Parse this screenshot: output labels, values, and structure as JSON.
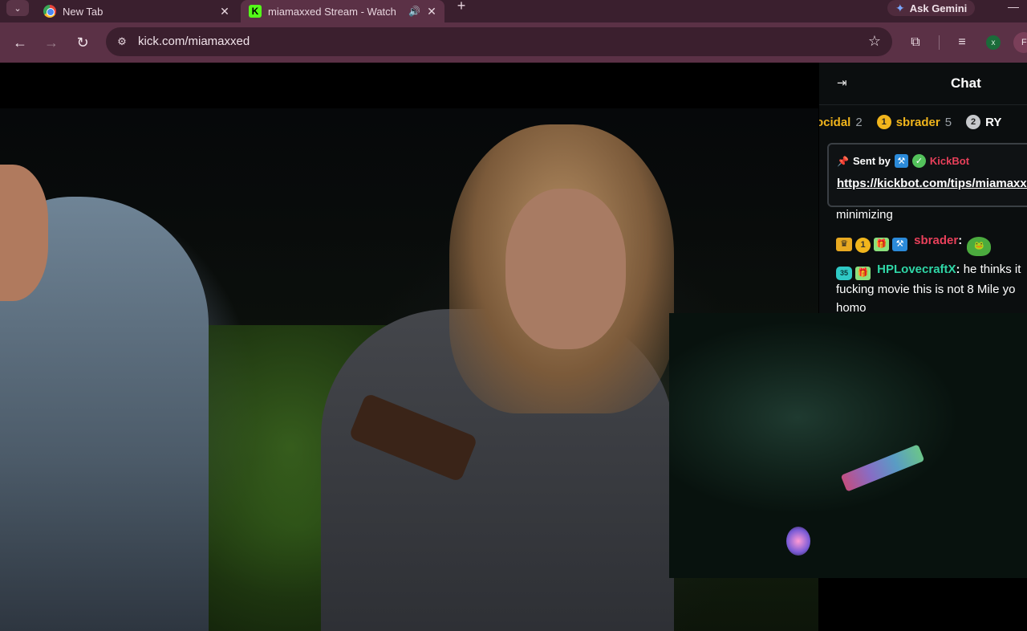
{
  "browser": {
    "tabs": [
      {
        "title": "New Tab",
        "favicon": "chrome-icon"
      },
      {
        "title": "miamaxxed Stream - Watch",
        "favicon": "kick-icon",
        "active": true
      }
    ],
    "gemini_label": "Ask Gemini",
    "url": "kick.com/miamaxxed",
    "profile_initial": "x",
    "profile_letter": "F"
  },
  "chat": {
    "title": "Chat",
    "gifters": [
      {
        "name": "ocidal",
        "count": "2",
        "rank": "",
        "rank_color": "#000"
      },
      {
        "name": "sbrader",
        "count": "5",
        "rank": "1",
        "rank_color": "#f1b51c"
      },
      {
        "name": "RY",
        "count": "",
        "rank": "2",
        "rank_color": "#c7c9cc"
      }
    ],
    "pinned": {
      "sent_by_label": "Sent by",
      "author": "KickBot",
      "author_color": "#e8405a",
      "link": "https://kickbot.com/tips/miamaxxed"
    },
    "messages": [
      {
        "user": "",
        "text": "minimizing"
      },
      {
        "user": "sbrader",
        "user_color": "#e8405a",
        "separator": ":",
        "text": ""
      },
      {
        "user": "HPLovecraftX",
        "user_color": "#2fd6a6",
        "separator": ":",
        "text": "he thinks it",
        "line2": "fucking movie this is not 8 Mile yo",
        "line3": "homo"
      }
    ]
  },
  "colors": {
    "brand": "#53fc18",
    "chrome_frame": "#5b3146",
    "chat_bg": "#0b0e0f"
  }
}
